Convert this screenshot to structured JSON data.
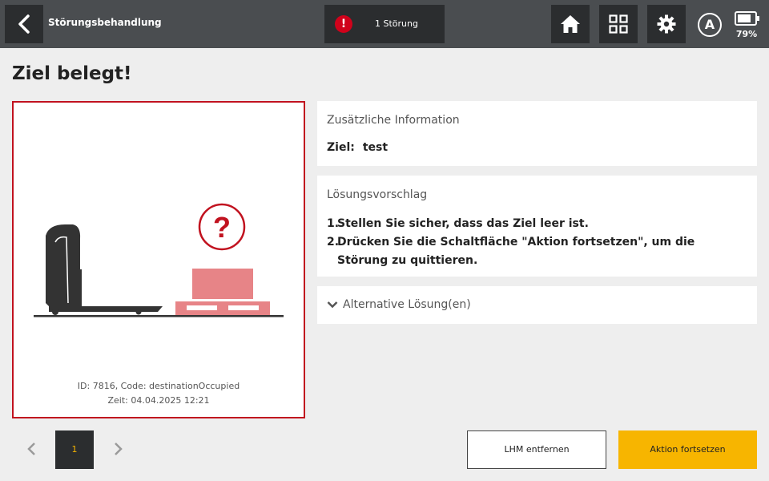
{
  "header": {
    "title": "Störungsbehandlung",
    "alert_icon": "!",
    "alert_text": "1 Störung",
    "auto_mode": "A",
    "battery_percent": "79%",
    "battery_level": 0.79
  },
  "page": {
    "title": "Ziel belegt!"
  },
  "illustration": {
    "question_mark": "?",
    "error_id": "ID: 7816, Code: destinationOccupied",
    "time": "Zeit: 04.04.2025 12:21"
  },
  "info_card": {
    "title": "Zusätzliche Information",
    "label": "Ziel:",
    "value": "test"
  },
  "solution_card": {
    "title": "Lösungsvorschlag",
    "steps": [
      {
        "num": "1.",
        "text": "Stellen Sie sicher, dass das Ziel leer ist."
      },
      {
        "num": "2.",
        "text": "Drücken Sie die Schaltfläche \"Aktion fortsetzen\", um die Störung zu quittieren."
      }
    ]
  },
  "alternative": {
    "label": "Alternative Lösung(en)"
  },
  "pager": {
    "current": "1"
  },
  "actions": {
    "remove_label": "LHM entfernen",
    "continue_label": "Aktion fortsetzen"
  },
  "colors": {
    "accent": "#f7b500",
    "error": "#c1121f",
    "topbar": "#4a4d50"
  }
}
